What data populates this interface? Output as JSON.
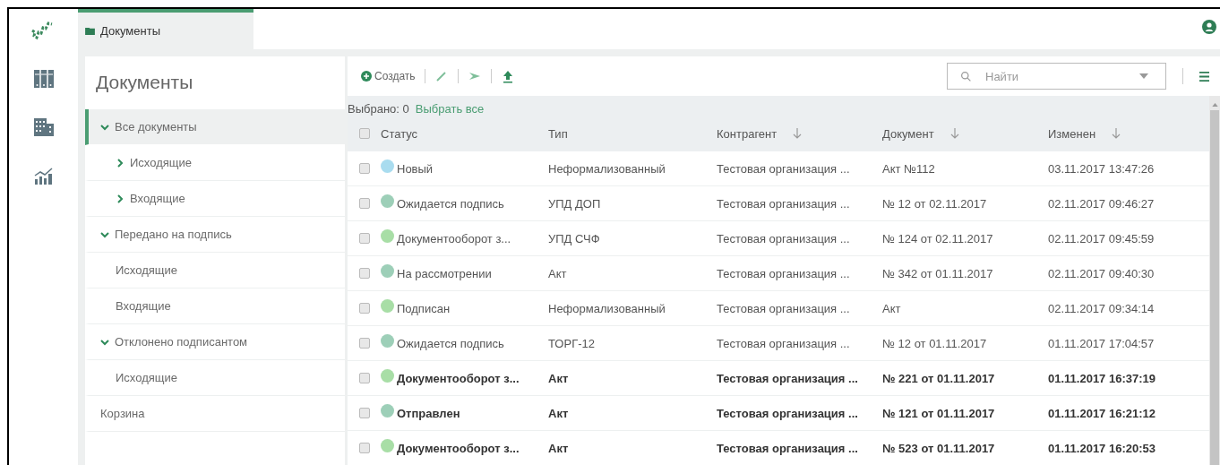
{
  "tab": {
    "label": "Документы",
    "selected": true
  },
  "sidebar": {
    "title": "Документы",
    "items": [
      {
        "label": "Все документы",
        "expanded": true,
        "selected": true,
        "children": [
          {
            "label": "Исходящие",
            "expanded": false,
            "selected": false
          },
          {
            "label": "Входящие",
            "expanded": false,
            "selected": false
          }
        ]
      },
      {
        "label": "Передано на подпись",
        "expanded": true,
        "selected": false,
        "children": [
          {
            "label": "Исходящие",
            "selected": false
          },
          {
            "label": "Входящие",
            "selected": false
          }
        ]
      },
      {
        "label": "Отклонено подписантом",
        "expanded": true,
        "selected": false,
        "children": [
          {
            "label": "Исходящие",
            "selected": false
          }
        ]
      },
      {
        "label": "Корзина",
        "selected": false
      }
    ]
  },
  "toolbar": {
    "create_label": "Создать",
    "search": {
      "placeholder": "Найти"
    }
  },
  "selection": {
    "count_label": "Выбрано: 0",
    "select_all": "Выбрать все"
  },
  "table": {
    "select_all_checked": false,
    "columns": [
      {
        "label": "Статус",
        "sort_arrow": false
      },
      {
        "label": "Тип",
        "sort_arrow": false
      },
      {
        "label": "Контрагент",
        "sort_arrow": true
      },
      {
        "label": "Документ",
        "sort_arrow": true
      },
      {
        "label": "Изменен",
        "sort_arrow": true
      }
    ],
    "rows": [
      {
        "checked": false,
        "unread": false,
        "color": "#a9dcef",
        "status": "Новый",
        "type": "Неформализованный",
        "counterparty": "Тестовая организация ...",
        "document": "Акт №112",
        "modified": "03.11.2017 13:47:26"
      },
      {
        "checked": false,
        "unread": false,
        "color": "#9dcfb8",
        "status": "Ожидается подпись",
        "type": "УПД ДОП",
        "counterparty": "Тестовая организация ...",
        "document": "№ 12 от 02.11.2017",
        "modified": "02.11.2017 09:46:27"
      },
      {
        "checked": false,
        "unread": false,
        "color": "#a8dea6",
        "status": "Документооборот з...",
        "type": "УПД СЧФ",
        "counterparty": "Тестовая организация ...",
        "document": "№ 124 от 02.11.2017",
        "modified": "02.11.2017 09:45:59"
      },
      {
        "checked": false,
        "unread": false,
        "color": "#9dcfb8",
        "status": "На рассмотрении",
        "type": "Акт",
        "counterparty": "Тестовая организация ...",
        "document": "№ 342 от 01.11.2017",
        "modified": "02.11.2017 09:40:30"
      },
      {
        "checked": false,
        "unread": false,
        "color": "#a8dea6",
        "status": "Подписан",
        "type": "Неформализованный",
        "counterparty": "Тестовая организация ...",
        "document": "Акт",
        "modified": "02.11.2017 09:34:14"
      },
      {
        "checked": false,
        "unread": false,
        "color": "#9dcfb8",
        "status": "Ожидается подпись",
        "type": "ТОРГ-12",
        "counterparty": "Тестовая организация ...",
        "document": "№ 12 от 01.11.2017",
        "modified": "01.11.2017 17:04:57"
      },
      {
        "checked": false,
        "unread": true,
        "color": "#a8dea6",
        "status": "Документооборот з...",
        "type": "Акт",
        "counterparty": "Тестовая организация ...",
        "document": "№ 221 от 01.11.2017",
        "modified": "01.11.2017 16:37:19"
      },
      {
        "checked": false,
        "unread": true,
        "color": "#9dcfb8",
        "status": "Отправлен",
        "type": "Акт",
        "counterparty": "Тестовая организация ...",
        "document": "№ 121 от 01.11.2017",
        "modified": "01.11.2017 16:21:12"
      },
      {
        "checked": false,
        "unread": true,
        "color": "#a8dea6",
        "status": "Документооборот з...",
        "type": "Акт",
        "counterparty": "Тестовая организация ...",
        "document": "№ 523 от 01.11.2017",
        "modified": "01.11.2017 16:20:53"
      }
    ]
  }
}
